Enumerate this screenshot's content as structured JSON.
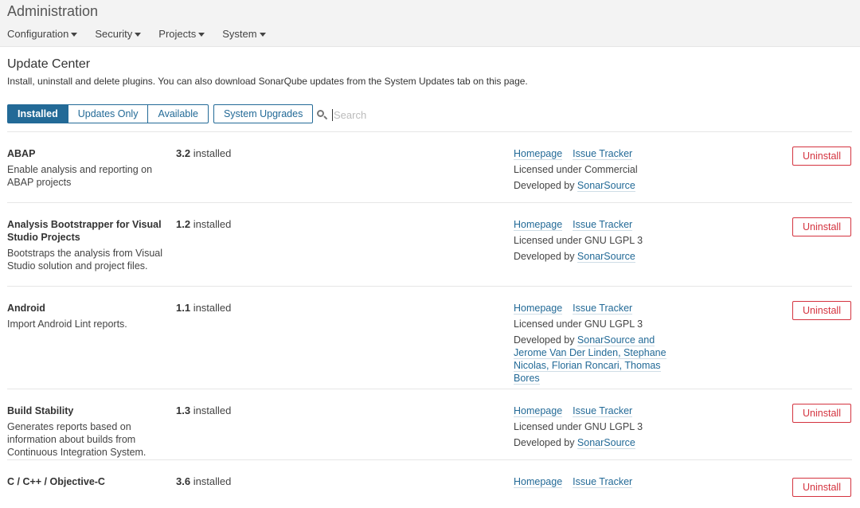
{
  "app": {
    "title": "Administration"
  },
  "menu": [
    {
      "label": "Configuration"
    },
    {
      "label": "Security"
    },
    {
      "label": "Projects"
    },
    {
      "label": "System"
    }
  ],
  "page": {
    "title": "Update Center",
    "description": "Install, uninstall and delete plugins. You can also download SonarQube updates from the System Updates tab on this page."
  },
  "tabs": {
    "installed": "Installed",
    "updates_only": "Updates Only",
    "available": "Available",
    "system_upgrades": "System Upgrades"
  },
  "search": {
    "placeholder": "Search",
    "value": ""
  },
  "labels": {
    "homepage": "Homepage",
    "issue_tracker": "Issue Tracker",
    "uninstall": "Uninstall",
    "installed_suffix": " installed",
    "licensed_prefix": "Licensed under ",
    "developed_prefix": "Developed by "
  },
  "plugins": [
    {
      "name": "ABAP",
      "description": "Enable analysis and reporting on ABAP projects",
      "version": "3.2",
      "license": "Commercial",
      "developer": "SonarSource"
    },
    {
      "name": "Analysis Bootstrapper for Visual Studio Projects",
      "description": "Bootstraps the analysis from Visual Studio solution and project files.",
      "version": "1.2",
      "license": "GNU LGPL 3",
      "developer": "SonarSource"
    },
    {
      "name": "Android",
      "description": "Import Android Lint reports.",
      "version": "1.1",
      "license": "GNU LGPL 3",
      "developer": "SonarSource and Jerome Van Der Linden, Stephane Nicolas, Florian Roncari, Thomas Bores"
    },
    {
      "name": "Build Stability",
      "description": "Generates reports based on information about builds from Continuous Integration System.",
      "version": "1.3",
      "license": "GNU LGPL 3",
      "developer": "SonarSource"
    },
    {
      "name": "C / C++ / Objective-C",
      "description": "",
      "version": "3.6",
      "license": "",
      "developer": ""
    }
  ]
}
